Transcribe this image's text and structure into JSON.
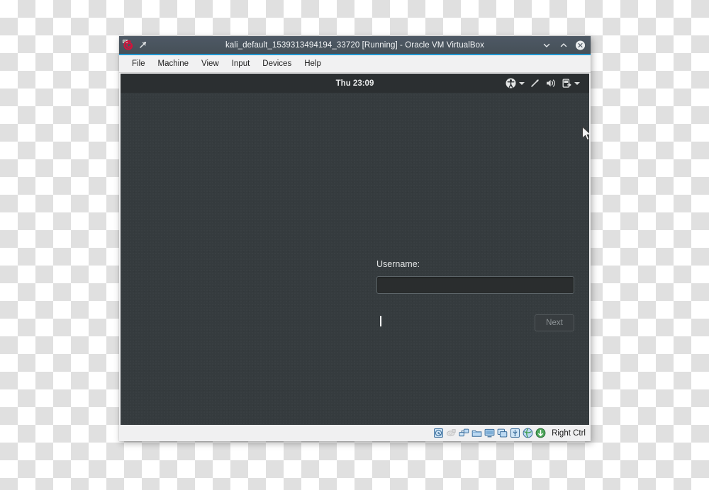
{
  "window": {
    "title": "kali_default_1539313494194_33720 [Running] - Oracle VM VirtualBox",
    "app_icon": "kali-dragon-icon",
    "pin_icon": "pin-icon",
    "controls": [
      {
        "name": "minimize-button",
        "icon": "chevron-down-icon"
      },
      {
        "name": "maximize-button",
        "icon": "chevron-up-icon"
      },
      {
        "name": "close-button",
        "icon": "close-circle-icon"
      }
    ],
    "title_bar_color": "#4a5560",
    "accent_color": "#2196cf"
  },
  "menu_bar": {
    "items": [
      {
        "label": "File"
      },
      {
        "label": "Machine"
      },
      {
        "label": "View"
      },
      {
        "label": "Input"
      },
      {
        "label": "Devices"
      },
      {
        "label": "Help"
      }
    ]
  },
  "guest": {
    "background_color": "#353b3e",
    "panel": {
      "clock": "Thu 23:09",
      "background_color": "#2b2f31",
      "status_items": [
        {
          "name": "universal-access-icon",
          "has_caret": true
        },
        {
          "name": "screen-brightness-icon",
          "has_caret": false
        },
        {
          "name": "volume-icon",
          "has_caret": false
        },
        {
          "name": "battery-icon",
          "has_caret": true
        }
      ]
    },
    "login": {
      "username_label": "Username:",
      "username_value": "",
      "username_placeholder": "",
      "next_label": "Next",
      "next_disabled": true
    }
  },
  "status_bar": {
    "icons": [
      {
        "name": "hard-disk-icon",
        "enabled": true
      },
      {
        "name": "optical-drive-icon",
        "enabled": false
      },
      {
        "name": "network-adapter-icon",
        "enabled": true
      },
      {
        "name": "shared-folders-icon",
        "enabled": true
      },
      {
        "name": "display-icon",
        "enabled": true
      },
      {
        "name": "video-capture-icon",
        "enabled": true
      },
      {
        "name": "usb-devices-icon",
        "enabled": true
      },
      {
        "name": "mouse-integration-icon",
        "enabled": true
      },
      {
        "name": "additions-icon",
        "enabled": true
      }
    ],
    "host_key_label": "Right Ctrl"
  }
}
